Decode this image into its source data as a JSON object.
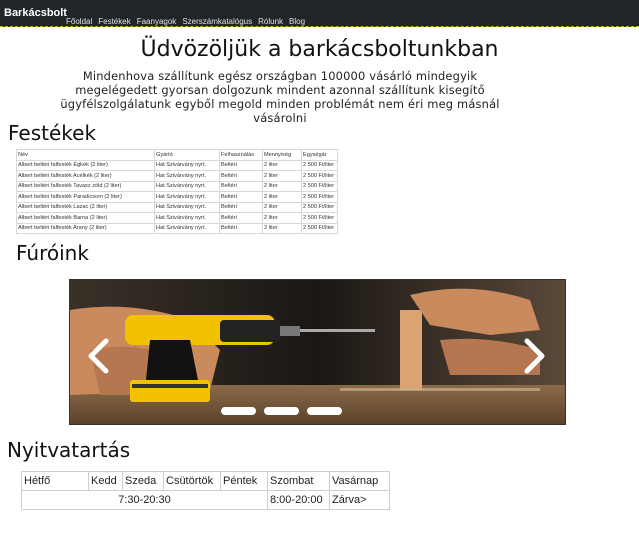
{
  "nav": {
    "brand": "Barkácsbolt",
    "links": [
      "Főoldal",
      "Festékek",
      "Faanyagok",
      "Szerszámkatalógus",
      "Rólunk",
      "Blog"
    ]
  },
  "hero": {
    "title": "Üdvözöljük a barkácsboltunkban",
    "intro": "Mindenhova szállítunk egész országban 100000 vásárló mindegyik megelégedett gyorsan dolgozunk mindent azonnal szállítunk kisegítő ügyfélszolgálatunk egyből megold minden problémát nem éri meg másnál vásárolni"
  },
  "paints": {
    "heading": "Festékek",
    "columns": [
      "Név",
      "Gyártó",
      "Felhasználás",
      "Mennyiség",
      "Egységár"
    ],
    "rows": [
      [
        "Albert beltéri falfesték Égkék (2 liter)",
        "Hat Szivárvány nyrt.",
        "Beltéri",
        "2 liter",
        "2 500 Ft/liter"
      ],
      [
        "Albert beltéri falfesték Acélkék (2 liter)",
        "Hat Szivárvány nyrt.",
        "Beltéri",
        "2 liter",
        "2 500 Ft/liter"
      ],
      [
        "Albert beltéri falfesték Tavasz zöld (2 liter)",
        "Hat Szivárvány nyrt.",
        "Beltéri",
        "2 liter",
        "2 500 Ft/liter"
      ],
      [
        "Albert beltéri falfesték Paradicsom (2 liter)",
        "Hat Szivárvány nyrt.",
        "Beltéri",
        "2 liter",
        "2 500 Ft/liter"
      ],
      [
        "Albert beltéri falfesték Lazac (2 liter)",
        "Hat Szivárvány nyrt.",
        "Beltéri",
        "2 liter",
        "2 500 Ft/liter"
      ],
      [
        "Albert beltéri falfesték Barna (2 liter)",
        "Hat Szivárvány nyrt.",
        "Beltéri",
        "2 liter",
        "2 500 Ft/liter"
      ],
      [
        "Albert beltéri falfesték Arany (2 liter)",
        "Hat Szivárvány nyrt.",
        "Beltéri",
        "2 liter",
        "2 500 Ft/liter"
      ]
    ]
  },
  "drills": {
    "heading": "Fúróink",
    "prev_icon": "chevron-left-icon",
    "next_icon": "chevron-right-icon",
    "slide_count": 3
  },
  "hours": {
    "heading": "Nyitvatartás",
    "days": [
      "Hétfő",
      "Kedd",
      "Szeda",
      "Csütörtök",
      "Péntek",
      "Szombat",
      "Vasárnap"
    ],
    "weekday": "7:30-20:30",
    "saturday": "8:00-20:00",
    "sunday": "Zárva>"
  },
  "colors": {
    "navbar": "#212529",
    "drill_yellow": "#f2c200"
  }
}
